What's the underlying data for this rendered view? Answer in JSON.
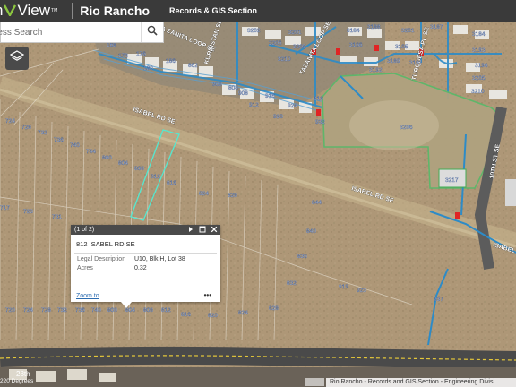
{
  "header": {
    "logo_n": "n",
    "logo_view": "View",
    "logo_tm": "TM",
    "city": "Rio Rancho",
    "section": "Records & GIS Section"
  },
  "search": {
    "placeholder": "ress Search"
  },
  "map": {
    "street_labels": {
      "tazanita_loop_1": "TA ZANITA LOOP SE",
      "kurdistan": "KURDISTAN SE",
      "tazanita_loop_2": "TAZANITA LOOP SE",
      "turquesa": "TURQUESA PL SE",
      "tenth_st": "10TH ST SE",
      "isabel_w": "ISABEL RD SE",
      "isabel_e": "ISABEL RD SE",
      "isabel_far": "ISABEL"
    },
    "parcel_numbers": [
      {
        "t": "168"
      },
      {
        "t": "172"
      },
      {
        "t": "176"
      },
      {
        "t": "180"
      },
      {
        "t": "186"
      },
      {
        "t": "862"
      },
      {
        "t": "900"
      },
      {
        "t": "804"
      },
      {
        "t": "908"
      },
      {
        "t": "912"
      },
      {
        "t": "916"
      },
      {
        "t": "920"
      },
      {
        "t": "924"
      },
      {
        "t": "3202"
      },
      {
        "t": "3206"
      },
      {
        "t": "3210"
      },
      {
        "t": "3201"
      },
      {
        "t": "3205"
      },
      {
        "t": "3184"
      },
      {
        "t": "3166"
      },
      {
        "t": "3188"
      },
      {
        "t": "3189"
      },
      {
        "t": "3192"
      },
      {
        "t": "3105"
      },
      {
        "t": "3201"
      },
      {
        "t": "3191"
      },
      {
        "t": "3187"
      },
      {
        "t": "3184"
      },
      {
        "t": "3193"
      },
      {
        "t": "3196"
      },
      {
        "t": "3205"
      },
      {
        "t": "3210"
      },
      {
        "t": "3206"
      },
      {
        "t": "932"
      },
      {
        "t": "816"
      },
      {
        "t": "724"
      },
      {
        "t": "728"
      },
      {
        "t": "732"
      },
      {
        "t": "736"
      },
      {
        "t": "740"
      },
      {
        "t": "744"
      },
      {
        "t": "800"
      },
      {
        "t": "804"
      },
      {
        "t": "808"
      },
      {
        "t": "812"
      },
      {
        "t": "816"
      },
      {
        "t": "824"
      },
      {
        "t": "828"
      },
      {
        "t": "717"
      },
      {
        "t": "723"
      },
      {
        "t": "731"
      },
      {
        "t": "844"
      },
      {
        "t": "840"
      },
      {
        "t": "836"
      },
      {
        "t": "832"
      },
      {
        "t": "919"
      },
      {
        "t": "923"
      },
      {
        "t": "937"
      },
      {
        "t": "3217"
      },
      {
        "t": "720"
      },
      {
        "t": "724"
      },
      {
        "t": "728"
      },
      {
        "t": "732"
      },
      {
        "t": "736"
      },
      {
        "t": "740"
      },
      {
        "t": "800"
      },
      {
        "t": "804"
      },
      {
        "t": "808"
      },
      {
        "t": "812"
      },
      {
        "t": "816"
      },
      {
        "t": "820"
      },
      {
        "t": "824"
      },
      {
        "t": "828"
      }
    ]
  },
  "popup": {
    "counter": "(1 of 2)",
    "title": "812 ISABEL RD SE",
    "rows": [
      {
        "key": "Legal Description",
        "value": "U10, Blk H, Lot 38"
      },
      {
        "key": "Acres",
        "value": "0.32"
      }
    ],
    "zoom_link": "Zoom to",
    "more": "•••"
  },
  "scale_text": "220 Degrees",
  "attribution": "Rio Rancho - Records and GIS Section - Engineering Divisi",
  "street_bottom": "28th"
}
